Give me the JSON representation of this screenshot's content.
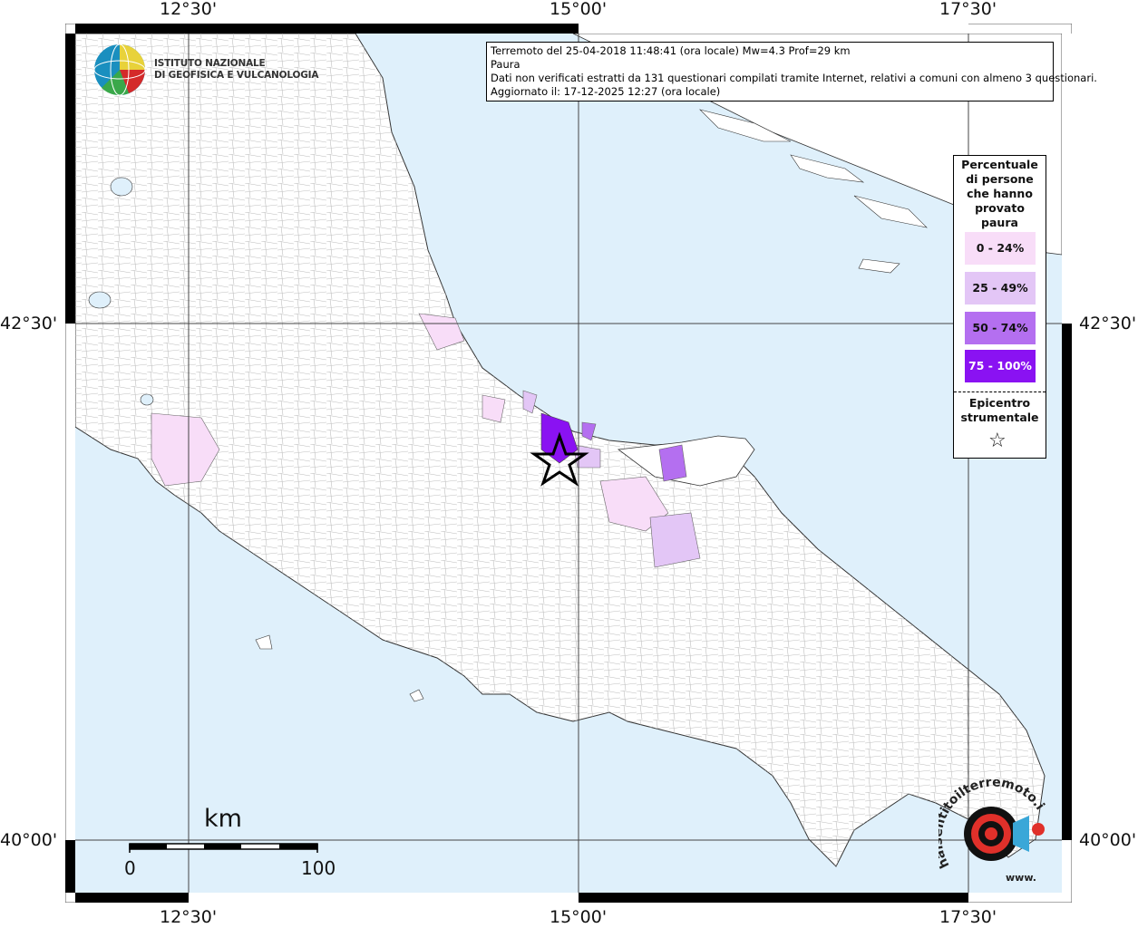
{
  "map": {
    "axis_labels": {
      "top": [
        "12°30'",
        "15°00'",
        "17°30'"
      ],
      "bottom": [
        "12°30'",
        "15°00'",
        "17°30'"
      ],
      "left": [
        "42°30'",
        "40°00'"
      ],
      "right": [
        "42°30'",
        "40°00'"
      ]
    },
    "colors": {
      "sea": "#dff0fb",
      "land": "#ffffff",
      "class_0_24": "#f8ddf8",
      "class_25_49": "#e3c6f6",
      "class_50_74": "#b46ff0",
      "class_75_100": "#8a12f2"
    }
  },
  "logo": {
    "line1": "ISTITUTO NAZIONALE",
    "line2": "DI GEOFISICA E VULCANOLOGIA"
  },
  "info": {
    "line1": "Terremoto del 25-04-2018 11:48:41 (ora locale) Mw=4.3 Prof=29 km",
    "line2": "Paura",
    "line3": "Dati non verificati estratti da 131 questionari compilati tramite Internet, relativi a comuni con almeno 3 questionari.",
    "line4": "Aggiornato il: 17-12-2025 12:27 (ora locale)"
  },
  "legend": {
    "title_lines": [
      "Percentuale",
      "di persone",
      "che hanno",
      "provato",
      "paura"
    ],
    "classes": [
      {
        "label": "0 - 24%",
        "color": "#f8ddf8",
        "text_color": "#111111"
      },
      {
        "label": "25 - 49%",
        "color": "#e3c6f6",
        "text_color": "#111111"
      },
      {
        "label": "50 - 74%",
        "color": "#b46ff0",
        "text_color": "#111111"
      },
      {
        "label": "75 - 100%",
        "color": "#8a12f2",
        "text_color": "#ffffff"
      }
    ],
    "epicenter_lines": [
      "Epicentro",
      "strumentale"
    ],
    "epicenter_symbol": "☆"
  },
  "scale": {
    "title": "km",
    "start": "0",
    "end": "100"
  },
  "badge": {
    "arc_text": "haisentitoilterremoto.it",
    "bottom_text": "www."
  }
}
